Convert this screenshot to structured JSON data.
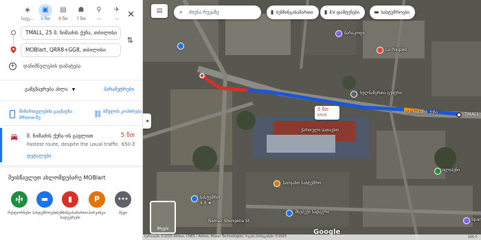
{
  "modes": [
    {
      "label": "საუკ...",
      "icon": "◈"
    },
    {
      "label": "5 წთ",
      "icon": "🚘"
    },
    {
      "label": "9 წთ",
      "icon": "🚌"
    },
    {
      "label": "7 წთ",
      "icon": "🚶"
    },
    {
      "label": "—",
      "icon": "🚲"
    },
    {
      "label": "—",
      "icon": "✈"
    }
  ],
  "route": {
    "origin": "TMALL, 25 შ. ნიშაძის ქუჩა, თბილისი",
    "destination": "MOBlart, QRR8+GG8, თბილისი",
    "add_stop": "დანიშნულების დამატება"
  },
  "depart": {
    "label": "გამგზავრება ახლა",
    "options": "პარამეტრები"
  },
  "send_phone": "მიმართულების გაგზავნა iPhone-ზე",
  "copy_link": "ბმულის კოპირება",
  "route_option": {
    "via": "შ. ნიშაძის ქუჩა-ის გავლით",
    "time": "5 წთ",
    "description": "Fastest route, despite the usual traffic",
    "distance": "650 მ",
    "details": "დეტალები"
  },
  "explore": {
    "title": "შეისწავლეთ ახლომდებარე MOBlart",
    "categories": [
      {
        "label": "რესტორნები",
        "color": "#1e8e3e",
        "icon": "🍴"
      },
      {
        "label": "სასტუმროები",
        "color": "#1a73e8",
        "icon": "▬"
      },
      {
        "label": "ბენზინგასამართი სადგურები",
        "color": "#d93025",
        "icon": "⛽"
      },
      {
        "label": "პარკინგი",
        "color": "#e37400",
        "icon": "P"
      },
      {
        "label": "მეტი",
        "color": "#5f6368",
        "icon": "•••"
      }
    ]
  },
  "map": {
    "search_placeholder": "ძიება რუკაზე",
    "chips": [
      {
        "label": "ბენზინგასამართი",
        "icon": "⛽"
      },
      {
        "label": "EV დამტენები",
        "icon": "⚡"
      },
      {
        "label": "სასტუმროები",
        "icon": "▬"
      }
    ],
    "route_badge_time": "5 წთ",
    "route_badge_dist": "650მ",
    "labels": {
      "tmall": "TMALL",
      "street_nishadze": "შ. ნიშაძის ქუჩა",
      "ramaz": "Ramaz Shengelia St",
      "poi_1": "ბარაკოფი",
      "poi_2": "La Poupée",
      "poi_3": "ხელნაწერთა ცენტრი",
      "poi_4": "საოჯახო სასტუმრო",
      "poi_5": "სასტუმრო",
      "poi_6": "4.6 ★",
      "poi_7": "მსუბუქი სადგური",
      "poi_8": "Spar",
      "poi_9": "ილიაუნი",
      "poi_10": "ქართული სათავსო"
    },
    "imagery_label": "შრეები",
    "google": "Google",
    "attribution": "სურათები ©2025 Airbus, CNES / Airbus, Maxar Technologies, რუკის მონაცემები ©2025",
    "scale": "100 მ"
  },
  "colors": {
    "accent": "#1a73e8",
    "traffic_red": "#d93025",
    "traffic_orange": "#f29900"
  }
}
